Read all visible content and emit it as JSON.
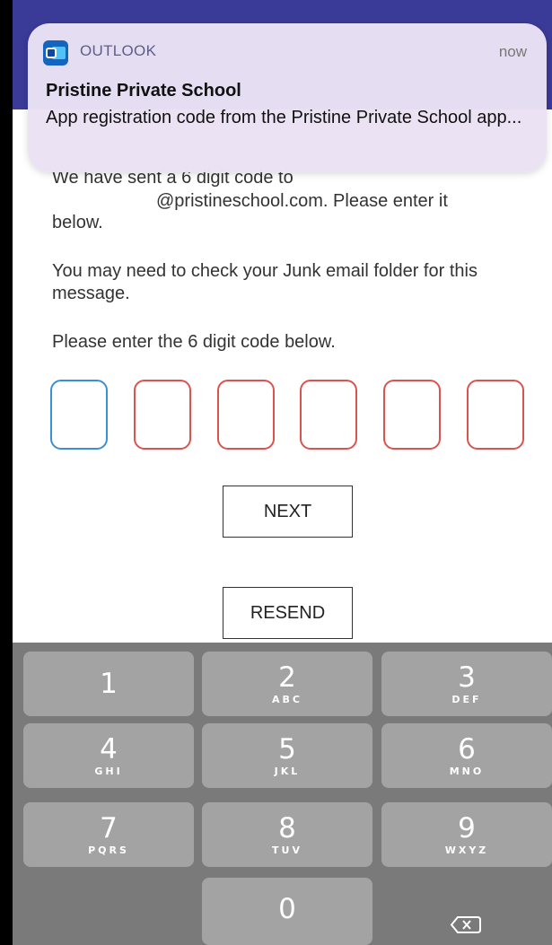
{
  "notification": {
    "app_name": "OUTLOOK",
    "time": "now",
    "title": "Pristine Private School",
    "body": "App registration code from the Pristine Private School app...",
    "icon": "outlook-icon"
  },
  "verification": {
    "sent_line1": "We have sent a 6 digit code to",
    "sent_line2": "@pristineschool.com. Please enter it",
    "sent_line3": "below.",
    "junk_note": "You may need to check your Junk email folder for this message.",
    "enter_prompt": "Please enter the 6 digit code below.",
    "code_digits": [
      "",
      "",
      "",
      "",
      "",
      ""
    ],
    "next_label": "NEXT",
    "resend_label": "RESEND"
  },
  "colors": {
    "header": "#3a3a98",
    "code_box_active": "#3b8fd6",
    "code_box_error": "#d9534f"
  },
  "keypad": {
    "keys": [
      {
        "num": "1",
        "letters": ""
      },
      {
        "num": "2",
        "letters": "ABC"
      },
      {
        "num": "3",
        "letters": "DEF"
      },
      {
        "num": "4",
        "letters": "GHI"
      },
      {
        "num": "5",
        "letters": "JKL"
      },
      {
        "num": "6",
        "letters": "MNO"
      },
      {
        "num": "7",
        "letters": "PQRS"
      },
      {
        "num": "8",
        "letters": "TUV"
      },
      {
        "num": "9",
        "letters": "WXYZ"
      },
      {
        "num": "0",
        "letters": ""
      }
    ],
    "delete_icon": "backspace-icon"
  }
}
